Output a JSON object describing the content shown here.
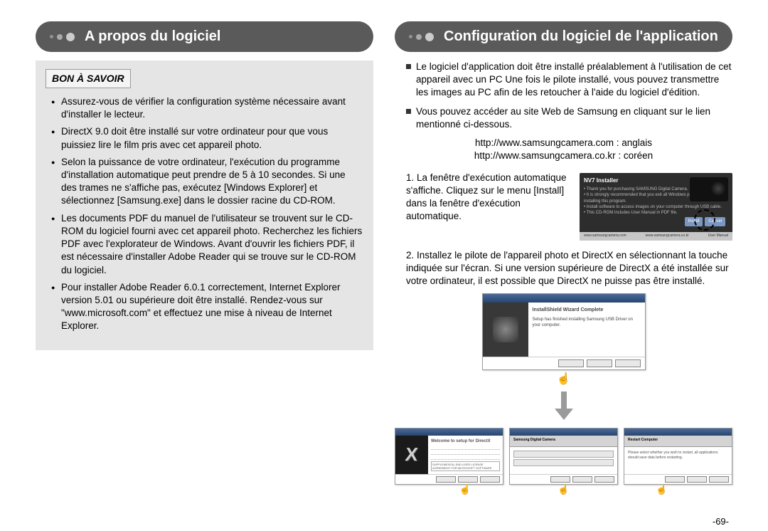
{
  "page_number": "-69-",
  "left": {
    "heading": "A propos du logiciel",
    "infobox_title": "BON À SAVOIR",
    "bullets": [
      "Assurez-vous de vérifier la configuration système nécessaire avant d'installer le lecteur.",
      "DirectX 9.0 doit être installé sur votre ordinateur pour que vous puissiez lire le film pris avec cet appareil photo.",
      "Selon la puissance de votre ordinateur, l'exécution du programme d'installation automatique peut prendre de 5 à 10 secondes. Si une des trames ne s'affiche pas, exécutez [Windows Explorer] et sélectionnez [Samsung.exe] dans le dossier racine du CD-ROM.",
      "Les documents PDF du manuel de l'utilisateur se trouvent sur le CD-ROM du logiciel fourni avec cet appareil photo. Recherchez les fichiers PDF avec l'explorateur de Windows. Avant d'ouvrir les fichiers PDF, il est nécessaire d'installer Adobe Reader qui se trouve sur le CD-ROM du logiciel.",
      "Pour installer Adobe Reader 6.0.1 correctement, Internet Explorer version 5.01 ou supérieure doit être installé. Rendez-vous sur \"www.microsoft.com\" et effectuez une mise à niveau de Internet Explorer."
    ]
  },
  "right": {
    "heading": "Configuration du logiciel de l'application",
    "intro_bullets": [
      "Le logiciel d'application doit être installé préalablement à l'utilisation de cet appareil avec un PC Une fois le pilote installé, vous pouvez transmettre les images au PC afin de les retoucher à l'aide du logiciel d'édition.",
      "Vous pouvez accéder au site Web de Samsung en cliquant sur le lien mentionné ci-dessous."
    ],
    "url_en": "http://www.samsungcamera.com : anglais",
    "url_kr": "http://www.samsungcamera.co.kr : coréen",
    "step1_num": "1.",
    "step1_text": "La fenêtre d'exécution automatique s'affiche. Cliquez sur le menu [Install] dans la fenêtre d'exécution automatique.",
    "step2_num": "2.",
    "step2_text": "Installez le pilote de l'appareil photo et DirectX en sélectionnant la touche indiquée sur l'écran. Si une version supérieure de DirectX a été installée sur votre ordinateur, il est possible que DirectX ne puisse pas être installé.",
    "installer": {
      "title": "NV7 Installer",
      "line1": "• Thank you for purchasing SAMSUNG Digital Camera.",
      "line2": "• It is strongly recommended that you exit all Windows programs before installing this program.",
      "line3": "• Install software to access images on your computer through USB cable.",
      "line4": "• This CD-ROM includes User Manual in PDF file.",
      "btn_install": "Install",
      "btn_cancel": "Cancel",
      "foot_left": "www.samsungcamera.com",
      "foot_mid": "www.samsungcamera.co.kr",
      "foot_right": "User Manual"
    },
    "wizard_complete": {
      "title": "InstallShield Wizard Complete",
      "body": "Setup has finished installing Samsung USB Driver on your computer."
    },
    "directx": {
      "title": "Welcome to setup for DirectX",
      "license_line": "SUPPLEMENTAL END USER LICENSE AGREEMENT FOR MICROSOFT SOFTWARE (\"Supplemental EULA\")"
    },
    "restart": {
      "head_small": "Samsung Digital Camera",
      "title": "Restart Computer",
      "body": "Please select whether you wish to restart, all applications should save data before restarting."
    }
  }
}
